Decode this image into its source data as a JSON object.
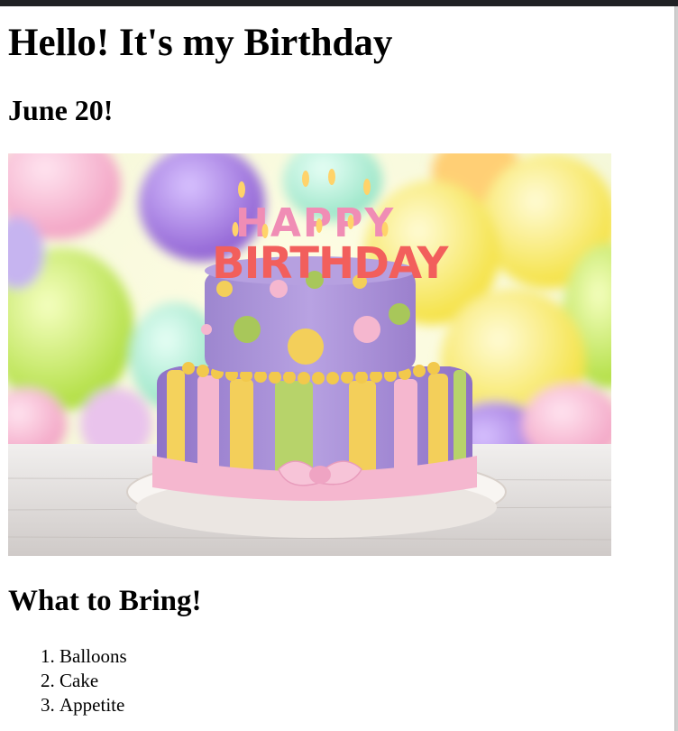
{
  "page": {
    "title": "Hello! It's my Birthday",
    "date": "June 20!",
    "image": {
      "icon": "birthday-cake-photo",
      "cake_topper_line1": "HAPPY",
      "cake_topper_line2": "BIRTHDAY",
      "colors": {
        "cake_purple": "#a98fd6",
        "ribbon_pink": "#f5b7cf",
        "stripe_yellow": "#f3cf5a",
        "stripe_green": "#b7d36a",
        "balloon_green": "#c9ef6a",
        "balloon_purple": "#a77fdc"
      }
    },
    "bring_heading": "What to Bring!",
    "bring_items": [
      "Balloons",
      "Cake",
      "Appetite"
    ]
  }
}
